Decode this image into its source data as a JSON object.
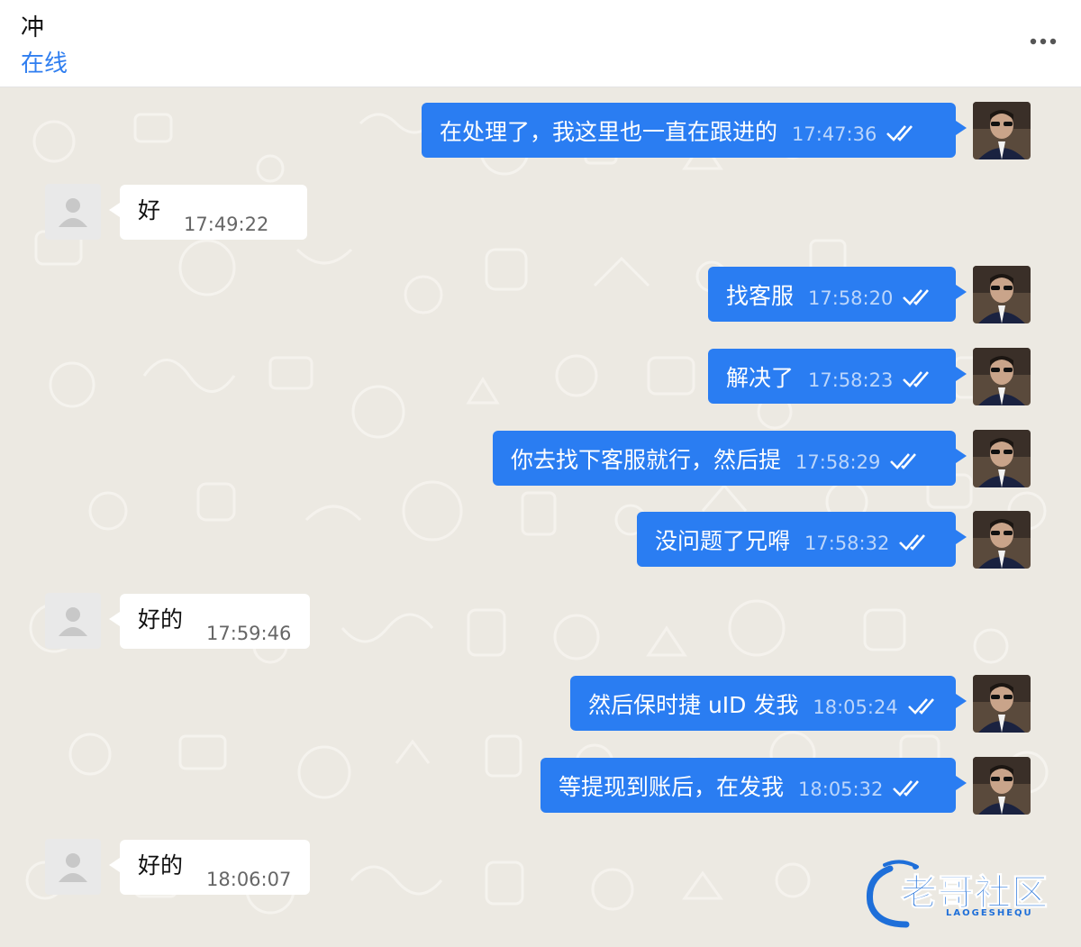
{
  "header": {
    "contact_name": "冲",
    "status": "在线",
    "more_icon": "more-horizontal-icon"
  },
  "colors": {
    "accent": "#2a7df2",
    "status": "#2f7ef0",
    "chat_background": "#ece9e2",
    "incoming_bubble": "#ffffff"
  },
  "messages": [
    {
      "direction": "outgoing",
      "text": "在处理了，我这里也一直在跟进的",
      "time": "17:47:36",
      "status_icon": "double-check-icon"
    },
    {
      "direction": "incoming",
      "text": "好",
      "time": "17:49:22"
    },
    {
      "direction": "outgoing",
      "text": "找客服",
      "time": "17:58:20",
      "status_icon": "double-check-icon"
    },
    {
      "direction": "outgoing",
      "text": "解决了",
      "time": "17:58:23",
      "status_icon": "double-check-icon"
    },
    {
      "direction": "outgoing",
      "text": "你去找下客服就行，然后提",
      "time": "17:58:29",
      "status_icon": "double-check-icon"
    },
    {
      "direction": "outgoing",
      "text": "没问题了兄嘚",
      "time": "17:58:32",
      "status_icon": "double-check-icon"
    },
    {
      "direction": "incoming",
      "text": "好的",
      "time": "17:59:46"
    },
    {
      "direction": "outgoing",
      "text": "然后保时捷 uID 发我",
      "time": "18:05:24",
      "status_icon": "double-check-icon"
    },
    {
      "direction": "outgoing",
      "text": "等提现到账后，在发我",
      "time": "18:05:32",
      "status_icon": "double-check-icon"
    },
    {
      "direction": "incoming",
      "text": "好的",
      "time": "18:06:07"
    }
  ],
  "watermark": {
    "text": "老哥社区",
    "subtext": "LAOGESHEQU"
  }
}
